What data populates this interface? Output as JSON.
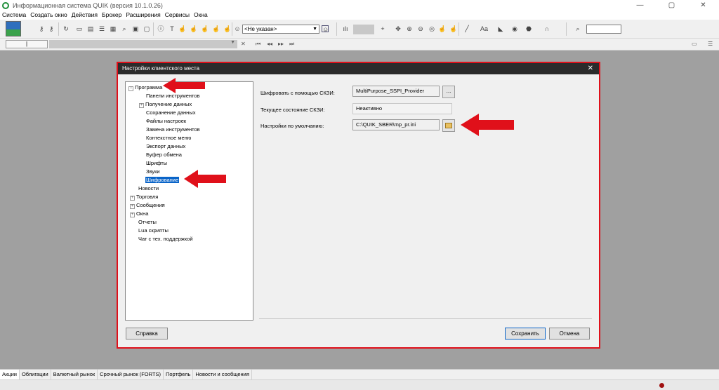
{
  "window": {
    "title": "Информационная система QUIK (версия 10.1.0.26)",
    "controls": [
      "—",
      "▢",
      "✕"
    ]
  },
  "menu": [
    "Система",
    "Создать окно",
    "Действия",
    "Брокер",
    "Расширения",
    "Сервисы",
    "Окна"
  ],
  "toolbar": {
    "account_select": "<Не указан>"
  },
  "toolbar2": {
    "field_value": "|"
  },
  "dialog": {
    "title": "Настройки клиентского места",
    "close": "✕",
    "tree": [
      {
        "label": "Программа",
        "level": 0,
        "expander": "−"
      },
      {
        "label": "Панели инструментов",
        "level": 1
      },
      {
        "label": "Получение данных",
        "level": 1,
        "expander": "+"
      },
      {
        "label": "Сохранение данных",
        "level": 1
      },
      {
        "label": "Файлы настроек",
        "level": 1
      },
      {
        "label": "Замена инструментов",
        "level": 1
      },
      {
        "label": "Контекстное меню",
        "level": 1
      },
      {
        "label": "Экспорт данных",
        "level": 1
      },
      {
        "label": "Буфер обмена",
        "level": 1
      },
      {
        "label": "Шрифты",
        "level": 1
      },
      {
        "label": "Звуки",
        "level": 1
      },
      {
        "label": "Шифрование",
        "level": 1,
        "selected": true
      },
      {
        "label": "Новости",
        "level": 0
      },
      {
        "label": "Торговля",
        "level": 0,
        "expander": "+"
      },
      {
        "label": "Сообщения",
        "level": 0,
        "expander": "+"
      },
      {
        "label": "Окна",
        "level": 0,
        "expander": "+"
      },
      {
        "label": "Отчеты",
        "level": 0
      },
      {
        "label": "Lua скрипты",
        "level": 0
      },
      {
        "label": "Чат с тех. поддержкой",
        "level": 0
      }
    ],
    "form": {
      "crypto_label": "Шифровать с помощью СКЗИ:",
      "crypto_value": "MultiPurpose_SSPI_Provider",
      "crypto_btn": "...",
      "state_label": "Текущее состояние СКЗИ:",
      "state_value": "Неактивно",
      "defaults_label": "Настройки по умолчанию:",
      "defaults_value": "C:\\QUIK_SBER\\mp_pr.ini"
    },
    "buttons": {
      "help": "Справка",
      "save": "Сохранить",
      "cancel": "Отмена"
    }
  },
  "bottom_tabs": [
    "Акции",
    "Облигации",
    "Валютный рынок",
    "Срочный рынок (FORTS)",
    "Портфель",
    "Новости и сообщения"
  ],
  "colors": {
    "highlight_border": "#e0101a",
    "selection": "#0a64c8",
    "arrow": "#e0101a"
  }
}
